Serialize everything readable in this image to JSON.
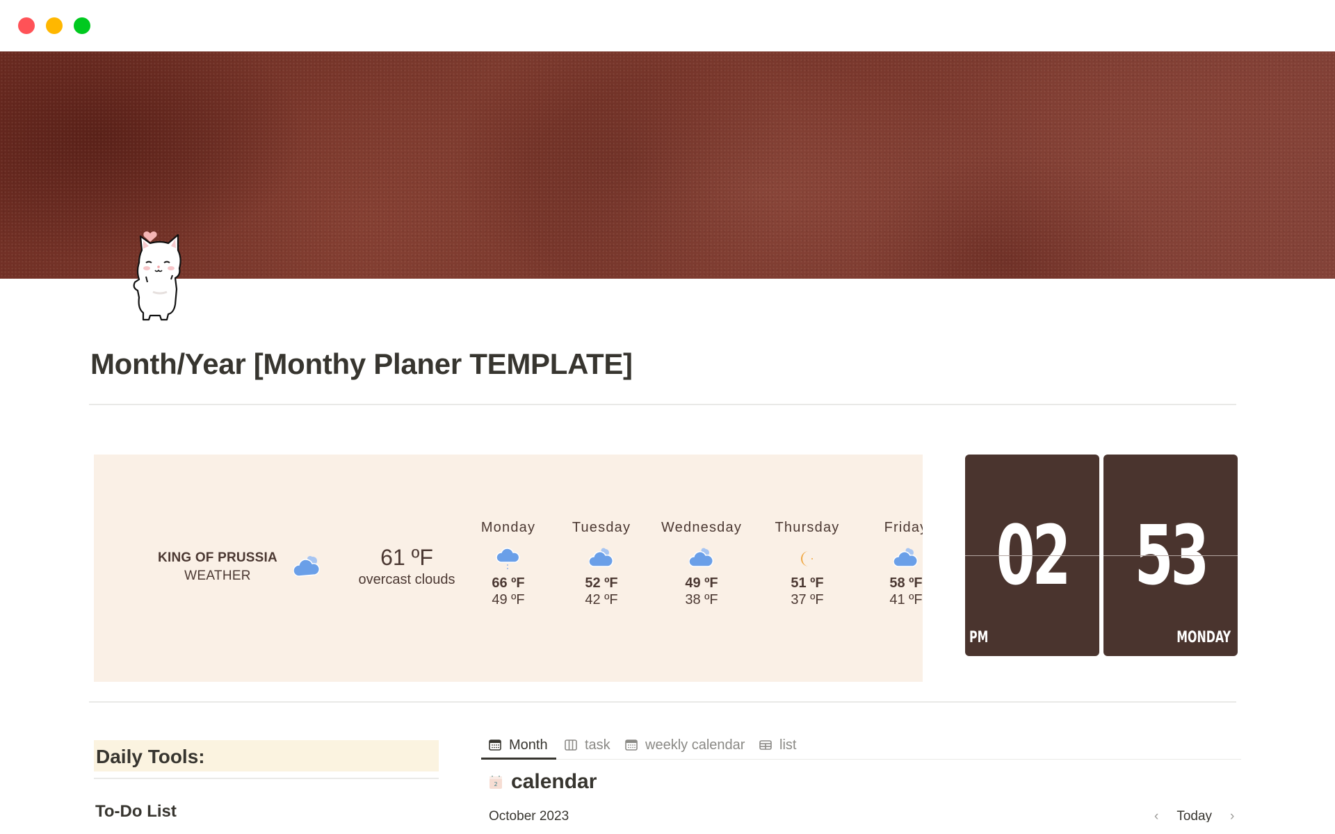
{
  "window": {
    "controls": [
      "close",
      "minimize",
      "maximize"
    ]
  },
  "page": {
    "icon": "pixel-cat-with-heart",
    "title": "Month/Year [Monthy Planer TEMPLATE]"
  },
  "weather": {
    "city": "KING OF PRUSSIA",
    "subtitle": "WEATHER",
    "current": {
      "icon": "cloud-icon",
      "temp": "61 ºF",
      "description": "overcast clouds"
    },
    "forecast": [
      {
        "day": "Monday",
        "icon": "rain-cloud-icon",
        "high": "66 ºF",
        "low": "49 ºF"
      },
      {
        "day": "Tuesday",
        "icon": "cloud-icon",
        "high": "52 ºF",
        "low": "42 ºF"
      },
      {
        "day": "Wednesday",
        "icon": "cloud-icon",
        "high": "49 ºF",
        "low": "38 ºF"
      },
      {
        "day": "Thursday",
        "icon": "moon-icon",
        "high": "51 ºF",
        "low": "37 ºF"
      },
      {
        "day": "Friday",
        "icon": "cloud-icon",
        "high": "58 ºF",
        "low": "41 ºF"
      }
    ],
    "colors": {
      "background": "#faf0e6",
      "text": "#4b3832",
      "cloud": "#6a9fe8",
      "moon": "#f0a640"
    }
  },
  "clock": {
    "hours": "02",
    "minutes": "53",
    "meridiem": "PM",
    "weekday": "MONDAY",
    "color": "#4a342e"
  },
  "daily_tools": {
    "heading": "Daily Tools:",
    "todo_title": "To-Do List"
  },
  "views": {
    "tabs": [
      {
        "label": "Month",
        "icon": "calendar-icon",
        "active": true
      },
      {
        "label": "task",
        "icon": "board-icon",
        "active": false
      },
      {
        "label": "weekly calendar",
        "icon": "calendar-icon",
        "active": false
      },
      {
        "label": "list",
        "icon": "table-icon",
        "active": false
      }
    ],
    "database_title": "calendar",
    "database_icon_day": "2",
    "current_month": "October 2023",
    "today_label": "Today",
    "prev_label": "‹",
    "next_label": "›"
  }
}
